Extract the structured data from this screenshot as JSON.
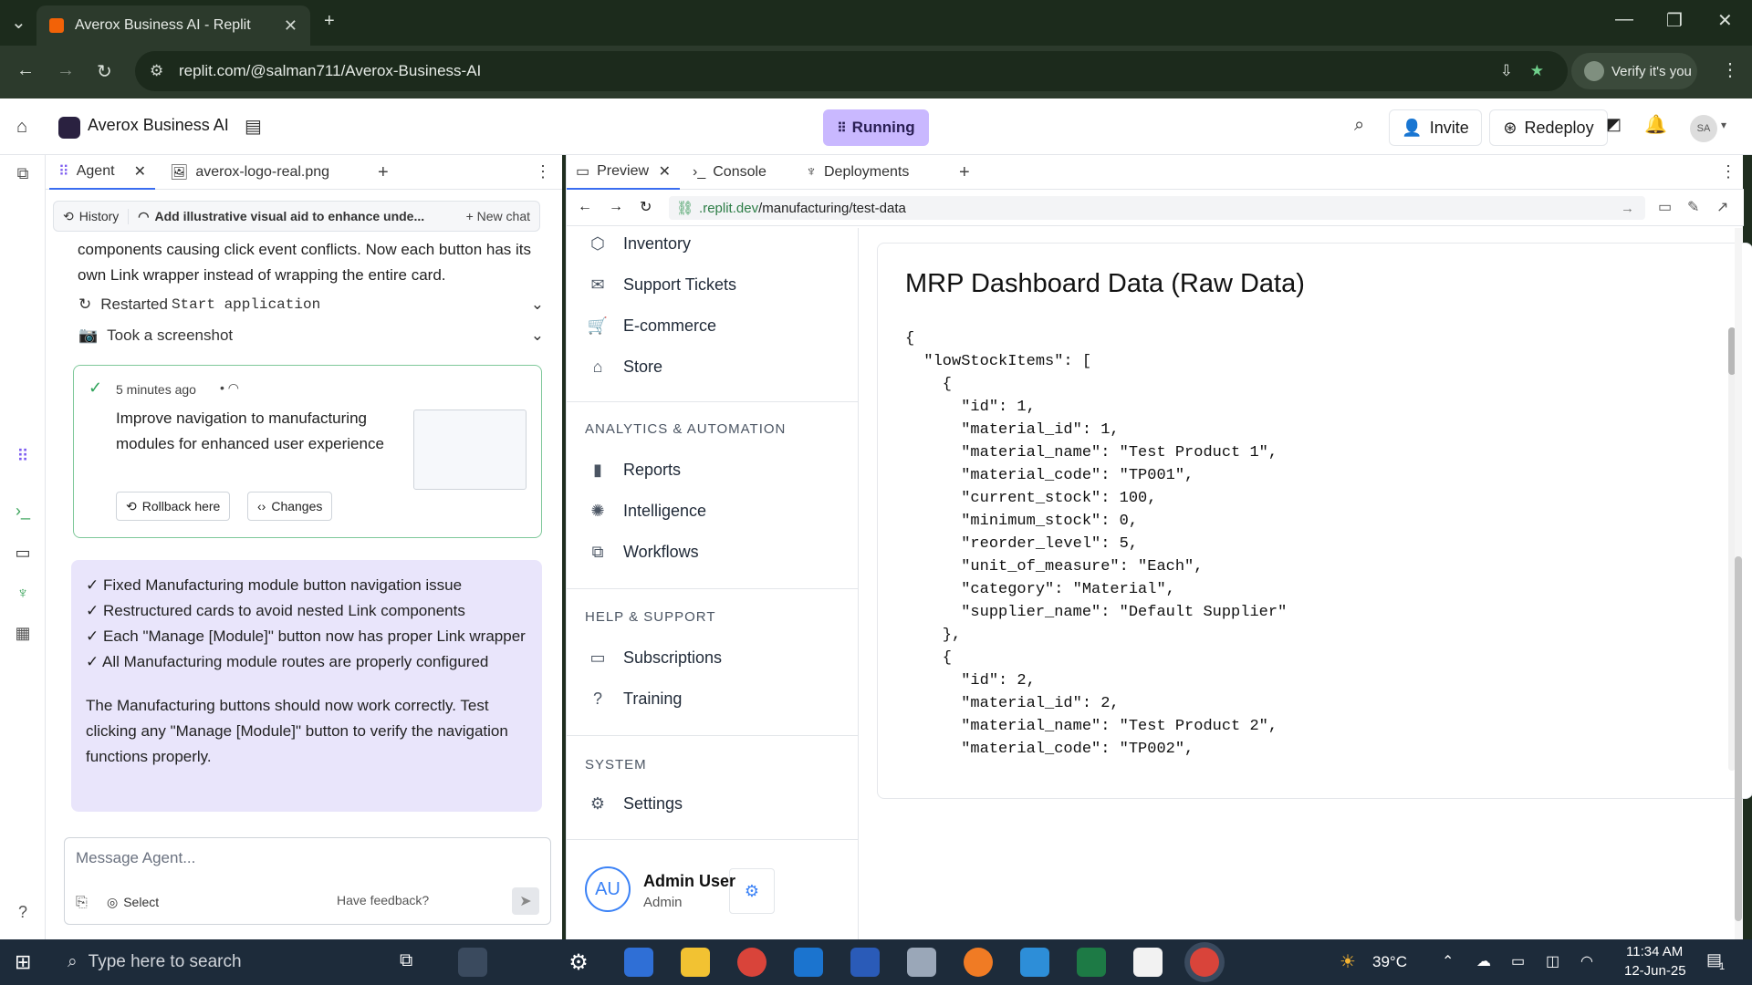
{
  "browser": {
    "tab_title": "Averox Business AI - Replit",
    "url": "replit.com/@salman711/Averox-Business-AI",
    "verify_label": "Verify it's you"
  },
  "replit": {
    "project_name": "Averox Business AI",
    "status": "Running",
    "invite_label": "Invite",
    "redeploy_label": "Redeploy",
    "avatar_initials": "SA"
  },
  "agent": {
    "tabs": [
      "Agent",
      "averox-logo-real.png"
    ],
    "history_label": "History",
    "chat_title": "Add illustrative visual aid to enhance unde...",
    "new_chat_label": "New chat",
    "intro_text": "components causing click event conflicts. Now each button has its own Link wrapper instead of wrapping the entire card.",
    "step_restart_prefix": "Restarted",
    "step_restart_code": "Start application",
    "step_screenshot": "Took a screenshot",
    "checkpoint_time": "5 minutes ago",
    "checkpoint_text": "Improve navigation to manufacturing modules for enhanced user experience",
    "rollback_label": "Rollback here",
    "changes_label": "Changes",
    "summary_items": [
      "✓ Fixed Manufacturing module button navigation issue",
      "✓ Restructured cards to avoid nested Link components",
      "✓ Each \"Manage [Module]\" button now has proper Link wrapper",
      "✓ All Manufacturing module routes are properly configured"
    ],
    "summary_text": "The Manufacturing buttons should now work correctly. Test clicking any \"Manage [Module]\" button to verify the navigation functions properly.",
    "message_placeholder": "Message Agent...",
    "select_label": "Select",
    "feedback_label": "Have feedback?"
  },
  "preview": {
    "tabs": [
      "Preview",
      "Console",
      "Deployments"
    ],
    "url_domain": ".replit.dev",
    "url_path": "/manufacturing/test-data"
  },
  "app_sidebar": {
    "top_items": [
      "Inventory",
      "Support Tickets",
      "E-commerce",
      "Store"
    ],
    "section_analytics": "ANALYTICS & AUTOMATION",
    "analytics_items": [
      "Reports",
      "Intelligence",
      "Workflows"
    ],
    "section_help": "HELP & SUPPORT",
    "help_items": [
      "Subscriptions",
      "Training"
    ],
    "section_system": "SYSTEM",
    "system_items": [
      "Settings"
    ],
    "user_initials": "AU",
    "user_name": "Admin User",
    "user_role": "Admin"
  },
  "data_card": {
    "title": "MRP Dashboard Data (Raw Data)",
    "json_lines": [
      "{",
      "  \"lowStockItems\": [",
      "    {",
      "      \"id\": 1,",
      "      \"material_id\": 1,",
      "      \"material_name\": \"Test Product 1\",",
      "      \"material_code\": \"TP001\",",
      "      \"current_stock\": 100,",
      "      \"minimum_stock\": 0,",
      "      \"reorder_level\": 5,",
      "      \"unit_of_measure\": \"Each\",",
      "      \"category\": \"Material\",",
      "      \"supplier_name\": \"Default Supplier\"",
      "    },",
      "    {",
      "      \"id\": 2,",
      "      \"material_id\": 2,",
      "      \"material_name\": \"Test Product 2\",",
      "      \"material_code\": \"TP002\","
    ]
  },
  "taskbar": {
    "search_placeholder": "Type here to search",
    "temperature": "39°C",
    "time": "11:34 AM",
    "date": "12-Jun-25",
    "notification_count": "1"
  }
}
